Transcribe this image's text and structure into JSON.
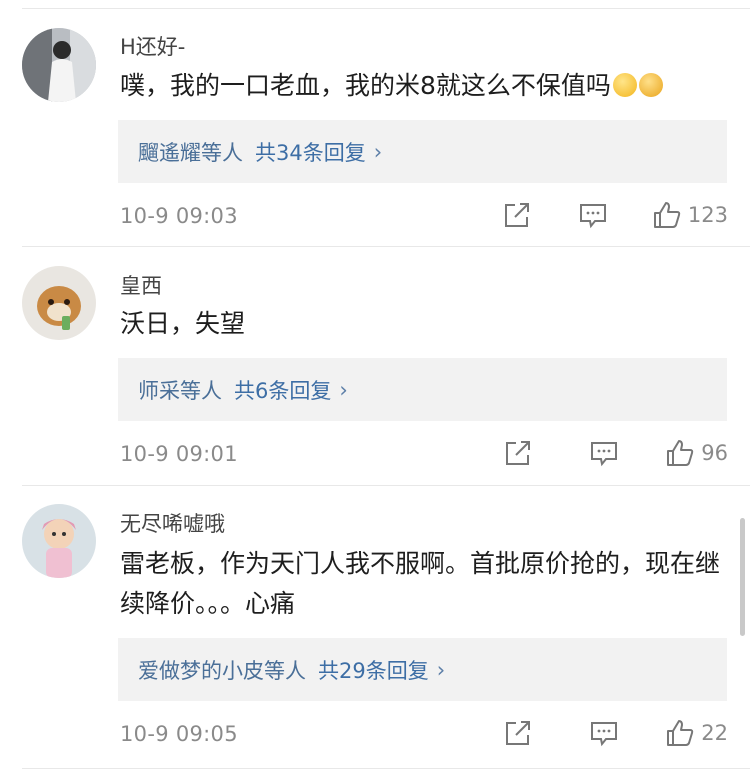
{
  "comments": [
    {
      "username": "H还好-",
      "text": "噗，我的一口老血，我的米8就这么不保值吗",
      "emojis": [
        "smile-emoji",
        "thumb-emoji"
      ],
      "reply_names": "飀遙耀等人",
      "reply_count": "共34条回复",
      "reply_chevron": "›",
      "time": "10-9 09:03",
      "likes": "123"
    },
    {
      "username": "皇西",
      "text": "沃日，失望",
      "reply_names": "师采等人",
      "reply_count": "共6条回复",
      "reply_chevron": "›",
      "time": "10-9 09:01",
      "likes": "96"
    },
    {
      "username": "无尽唏嘘哦",
      "text": "雷老板，作为天门人我不服啊。首批原价抢的，现在继续降价。。。心痛",
      "reply_names": "爱做梦的小皮等人",
      "reply_count": "共29条回复",
      "reply_chevron": "›",
      "time": "10-9 09:05",
      "likes": "22"
    }
  ],
  "colors": {
    "link": "#3d6ea5",
    "reply_bg": "#f2f2f2",
    "meta_gray": "#8a8a8a"
  },
  "icons": {
    "repost": "repost-icon",
    "comment": "comment-icon",
    "like": "thumbs-up-icon"
  }
}
